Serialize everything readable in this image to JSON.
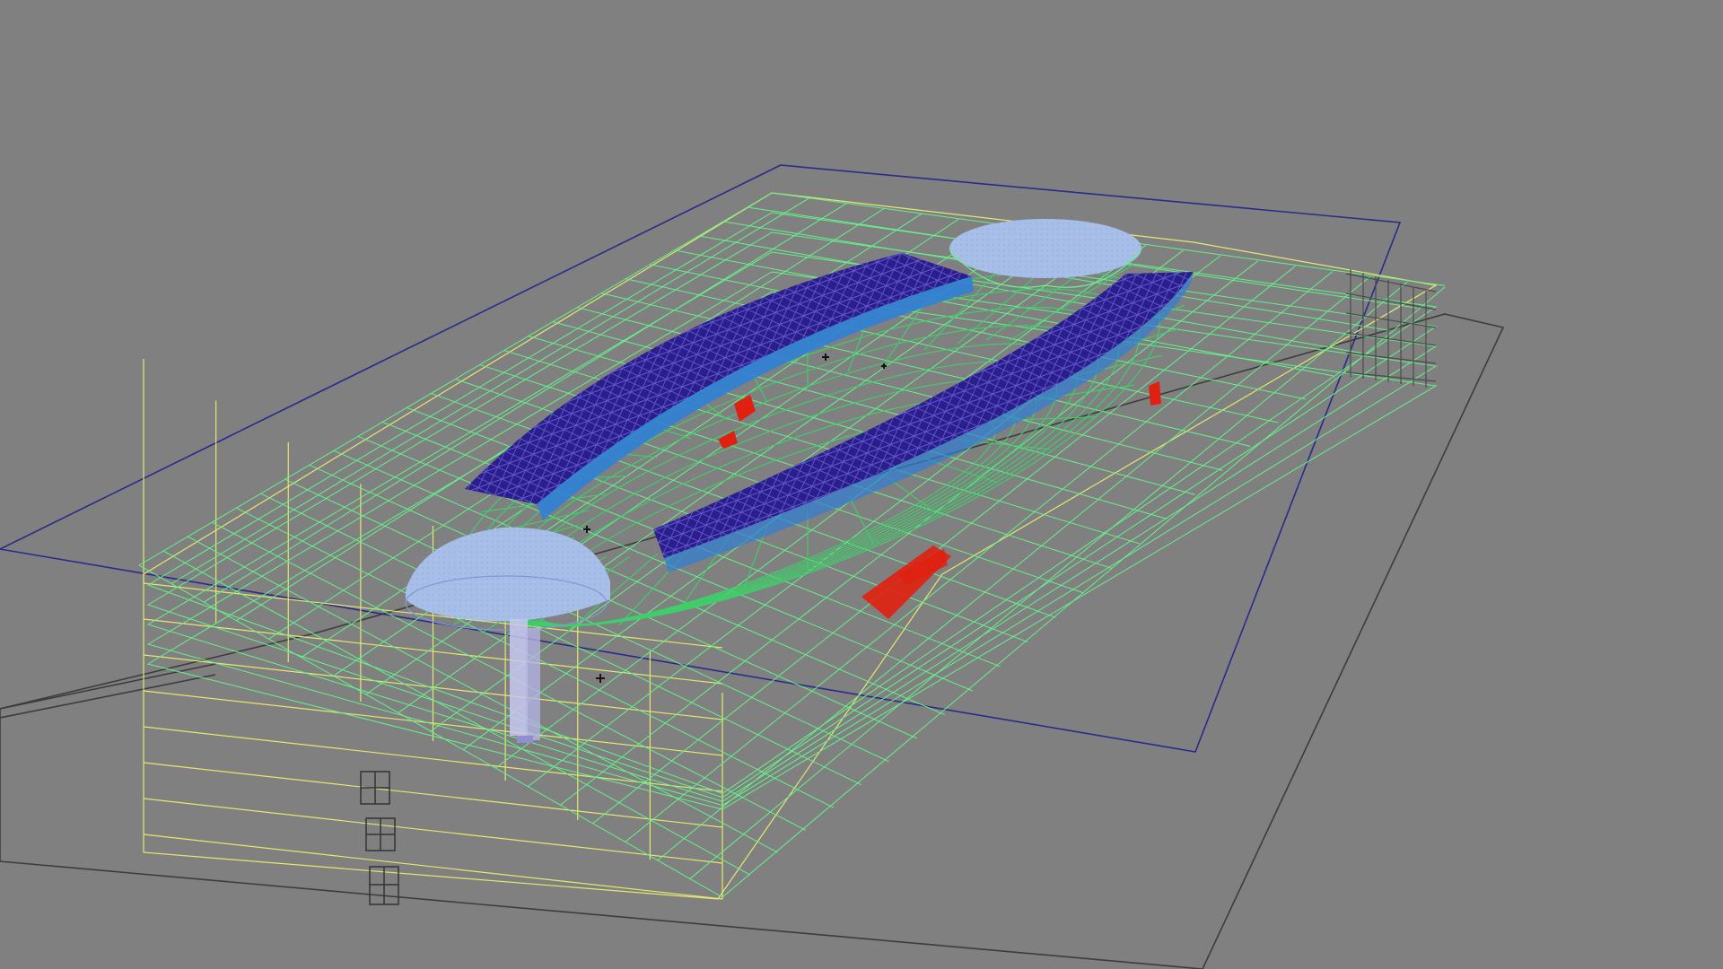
{
  "viewport": {
    "background": "#808080",
    "render_mode": "wireframe",
    "subject": "building-model"
  },
  "colors": {
    "ground_line": "#3c3c3c",
    "site_boundary": "#2a2a8a",
    "structure_wire": "#66f08a",
    "structure_wire_dark": "#3fcf6a",
    "outline_wire": "#e4e870",
    "roof_fill": "#2a1e8c",
    "roof_mesh": "#6a5fd8",
    "roof_side": "#2f7fd6",
    "dome": "#a6bee8",
    "column": "#c8c8f0",
    "highlight": "#e02010",
    "marker": "#141414"
  },
  "icons": {
    "door": "door-frame-icon",
    "marker": "crosshair-marker-icon"
  }
}
